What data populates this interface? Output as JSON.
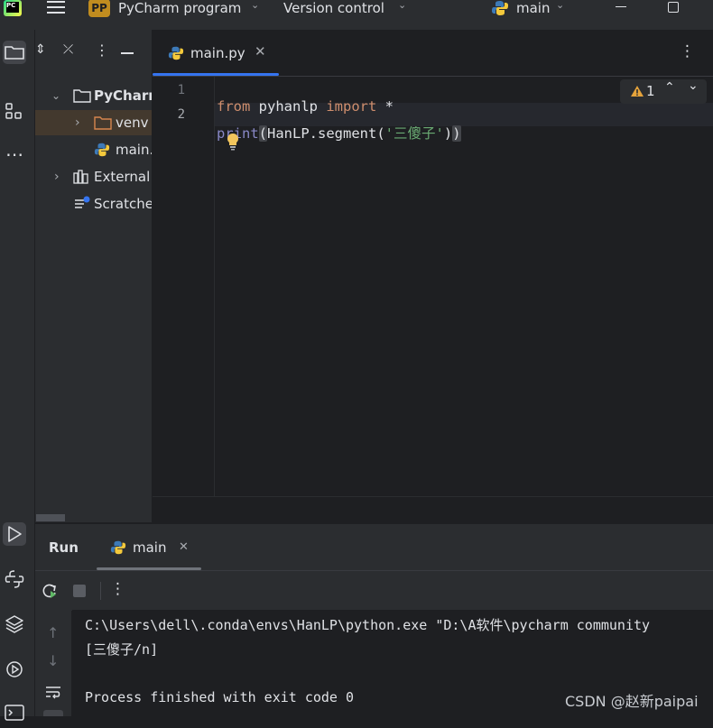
{
  "titlebar": {
    "project_badge": "PP",
    "project_name": "PyCharm program",
    "vcs": "Version control",
    "run_config": "main"
  },
  "project_tree": {
    "root": "PyCharm",
    "items": [
      {
        "label": "venv"
      },
      {
        "label": "main."
      },
      {
        "label": "External"
      },
      {
        "label": "Scratche"
      }
    ]
  },
  "editor": {
    "tab_label": "main.py",
    "warning_count": "1",
    "line_numbers": [
      "1",
      "2"
    ],
    "line1": {
      "kw1": "from",
      "mod": " pyhanlp ",
      "kw2": "import",
      "rest": " *"
    },
    "line2": {
      "fn": "print",
      "open": "(",
      "mid": "HanLP.segment(",
      "str": "'三傻子'",
      "close1": ")",
      "close2": ")"
    }
  },
  "run": {
    "title": "Run",
    "tab_label": "main",
    "output": [
      "C:\\Users\\dell\\.conda\\envs\\HanLP\\python.exe \"D:\\A软件\\pycharm community",
      "[三傻子/n]",
      "",
      "Process finished with exit code 0"
    ]
  },
  "watermark": "CSDN @赵新paipai",
  "colors": {
    "accent": "#3574f0",
    "keyword": "#cf8e6d",
    "string": "#6aab73",
    "builtin": "#8888c6",
    "warning": "#e5a33b"
  }
}
